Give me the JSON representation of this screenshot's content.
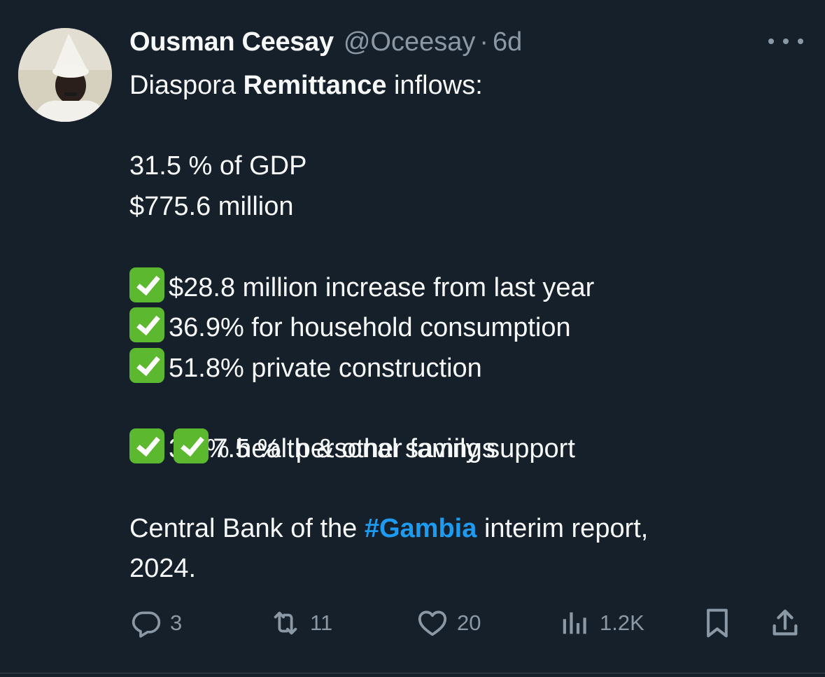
{
  "tweet": {
    "author": {
      "display_name": "Ousman Ceesay",
      "handle": "@Oceesay",
      "separator": "·",
      "time": "6d"
    },
    "text": {
      "line1_pre": "Diaspora ",
      "line1_bold": "Remittance",
      "line1_post": " inflows:",
      "gdp": "31.5 % of GDP",
      "amount": "$775.6 million",
      "checks": [
        "$28.8 million increase from last year",
        "36.9% for household consumption",
        "51.8% private construction",
        "7.5 %  personal savings",
        "3.8% health & other family support"
      ],
      "source_pre": "Central Bank of the ",
      "source_hashtag": "#Gambia",
      "source_post": " interim report,",
      "source_year": "2024."
    },
    "actions": {
      "replies": "3",
      "retweets": "11",
      "likes": "20",
      "views": "1.2K"
    },
    "icons": {
      "reply": "reply-icon",
      "retweet": "retweet-icon",
      "like": "heart-icon",
      "views": "views-icon",
      "bookmark": "bookmark-icon",
      "share": "share-icon",
      "more": "more-icon",
      "check": "check-mark-icon"
    },
    "colors": {
      "background": "#15202b",
      "text": "#f7f9f9",
      "muted": "#8b98a5",
      "link": "#1d9bf0",
      "check": "#5cb82e"
    }
  }
}
